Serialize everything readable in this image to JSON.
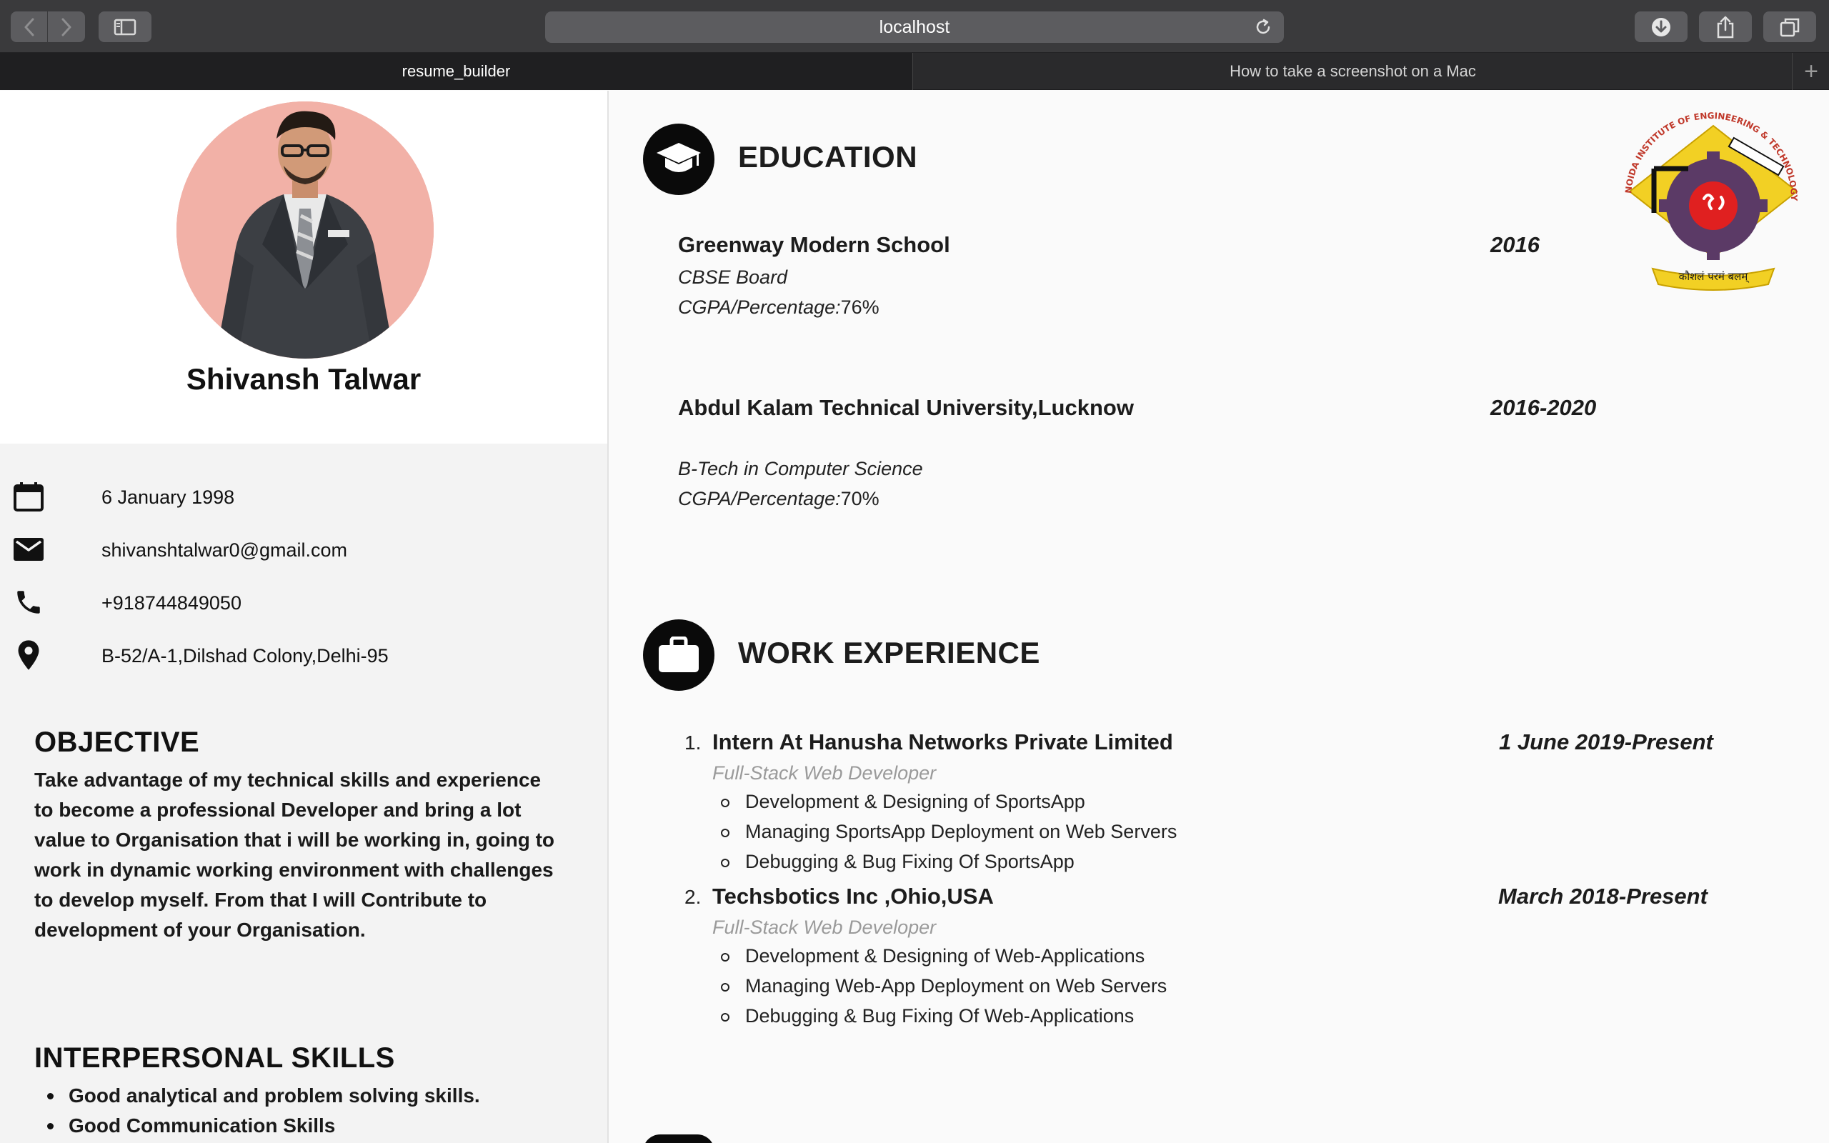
{
  "browser": {
    "url": "localhost",
    "tabs": [
      {
        "label": "resume_builder",
        "active": true
      },
      {
        "label": "How to take a screenshot on a Mac",
        "active": false
      }
    ]
  },
  "profile": {
    "name": "Shivansh Talwar"
  },
  "contact": {
    "dob": "6 January 1998",
    "email": "shivanshtalwar0@gmail.com",
    "phone": "+918744849050",
    "address": "B-52/A-1,Dilshad Colony,Delhi-95"
  },
  "objective": {
    "title": "OBJECTIVE",
    "text": "Take advantage of my technical skills and experience to become a professional Developer and bring a lot value to Organisation that i will be working in, going to work in dynamic working environment with challenges to develop myself. From that I will Contribute to development of your Organisation."
  },
  "skills": {
    "title": "INTERPERSONAL SKILLS",
    "items": [
      "Good analytical and problem solving skills.",
      "Good Communication Skills"
    ]
  },
  "education": {
    "title": "EDUCATION",
    "entries": [
      {
        "institution": "Greenway Modern School",
        "year": "2016",
        "line1": "CBSE Board",
        "cgpa_label": "CGPA/Percentage:",
        "cgpa_value": "76%"
      },
      {
        "institution": "Abdul Kalam Technical University,Lucknow",
        "year": "2016-2020",
        "line1": "B-Tech in Computer Science",
        "cgpa_label": "CGPA/Percentage:",
        "cgpa_value": "70%"
      }
    ]
  },
  "logo": {
    "arc_text": "NOIDA INSTITUTE OF ENGINEERING & TECHNOLOGY",
    "motto": "कौशलं परमं बलम्"
  },
  "experience": {
    "title": "WORK EXPERIENCE",
    "jobs": [
      {
        "number": "1.",
        "title": "Intern At Hanusha Networks Private Limited",
        "date": "1 June 2019-Present",
        "role": "Full-Stack Web Developer",
        "tasks": [
          "Development & Designing of SportsApp",
          "Managing SportsApp Deployment on Web Servers",
          "Debugging & Bug Fixing Of SportsApp"
        ]
      },
      {
        "number": "2.",
        "title": "Techsbotics Inc ,Ohio,USA",
        "date": "March 2018-Present",
        "role": "Full-Stack Web Developer",
        "tasks": [
          "Development & Designing of Web-Applications",
          "Managing Web-App Deployment on Web Servers",
          "Debugging & Bug Fixing Of Web-Applications"
        ]
      }
    ]
  }
}
